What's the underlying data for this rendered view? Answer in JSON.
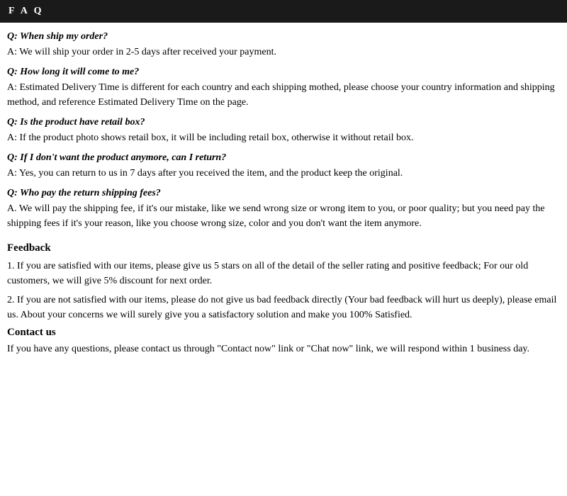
{
  "header": {
    "title": "F A Q"
  },
  "faq": {
    "items": [
      {
        "question": "Q: When ship my order?",
        "answer": "A: We will ship your order in 2-5 days after received your payment."
      },
      {
        "question": "Q: How long it will come to me?",
        "answer": "A: Estimated Delivery Time is different for each country and each shipping mothed, please choose your country information and shipping method, and reference Estimated Delivery Time on the page."
      },
      {
        "question": "Q: Is the product have retail box?",
        "answer": "A: If  the product photo shows retail box, it will be including retail box, otherwise it without retail box."
      },
      {
        "question": "Q: If  I don't want the product anymore, can I return?",
        "answer": "A: Yes, you can return to us in 7 days after you received the item, and the product keep the original."
      },
      {
        "question": "Q: Who pay the return shipping fees?",
        "answer": "A.  We will pay the shipping fee, if  it's our mistake, like we send wrong size or wrong item to you, or poor quality; but you need pay the shipping fees if  it's your reason, like you choose wrong size, color and you don't want the item anymore."
      }
    ]
  },
  "feedback": {
    "title": "Feedback",
    "items": [
      "1.  If you are satisfied with our items, please give us 5 stars on all of the detail of the seller rating and positive feedback; For our old customers, we will give 5% discount for next order.",
      "2.  If you are not satisfied with our items, please do not give us bad feedback directly (Your bad feedback will hurt us deeply), please email us. About your concerns we will surely give you a satisfactory solution and make you 100% Satisfied."
    ]
  },
  "contact": {
    "title": "Contact us",
    "text": "If you have any questions, please contact us through \"Contact now\" link or \"Chat now\" link, we will respond within 1 business day."
  }
}
